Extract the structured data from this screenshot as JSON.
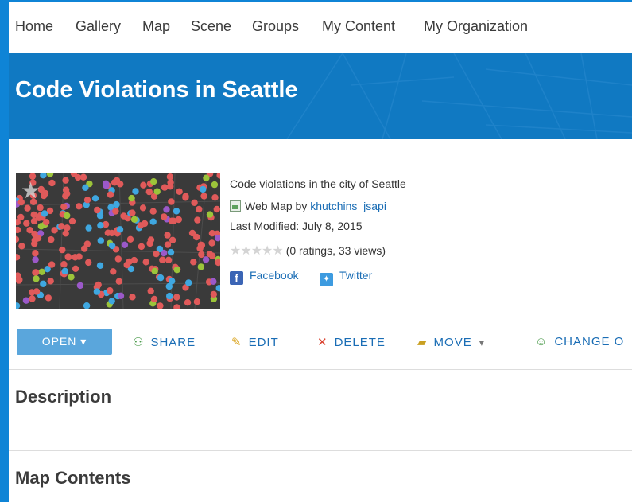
{
  "nav": {
    "items": [
      "Home",
      "Gallery",
      "Map",
      "Scene",
      "Groups",
      "My Content",
      "My Organization"
    ]
  },
  "banner": {
    "title": "Code Violations in Seattle"
  },
  "item": {
    "summary": "Code violations in the city of Seattle",
    "type_prefix": "Web Map by",
    "owner": "khutchins_jsapi",
    "last_modified": "Last Modified: July 8, 2015",
    "ratings": "(0 ratings, 33 views)",
    "share": {
      "facebook": "Facebook",
      "twitter": "Twitter"
    }
  },
  "toolbar": {
    "open": "OPEN",
    "share": "SHARE",
    "edit": "EDIT",
    "delete": "DELETE",
    "move": "MOVE",
    "change_owner": "CHANGE O"
  },
  "sections": {
    "description": "Description",
    "map_contents": "Map Contents"
  },
  "colors": {
    "background": "#0f84d6",
    "banner": "#1079c2",
    "button": "#5aa6dc",
    "link": "#1a6db5",
    "point_colors": [
      "#e05a5a",
      "#3fa7e0",
      "#9cc43a",
      "#9b59c9"
    ]
  }
}
